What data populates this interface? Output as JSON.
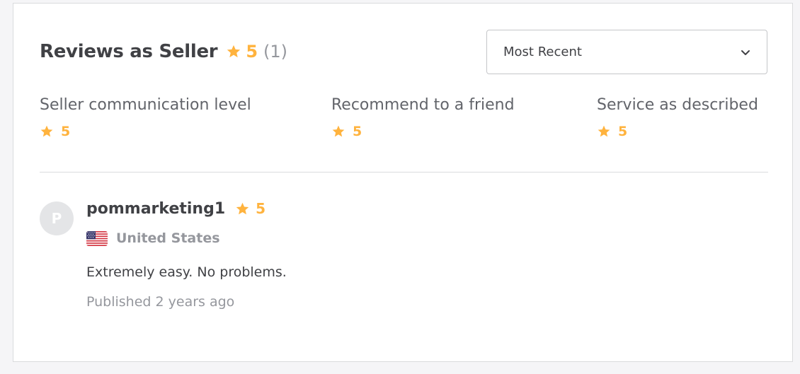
{
  "header": {
    "title": "Reviews as Seller",
    "rating": "5",
    "count": "(1)"
  },
  "sort": {
    "selected": "Most Recent"
  },
  "breakdown": [
    {
      "label": "Seller communication level",
      "value": "5"
    },
    {
      "label": "Recommend to a friend",
      "value": "5"
    },
    {
      "label": "Service as described",
      "value": "5"
    }
  ],
  "review": {
    "avatar_initial": "P",
    "username": "pommarketing1",
    "rating": "5",
    "country": "United States",
    "text": "Extremely easy. No problems.",
    "published": "Published 2 years ago"
  },
  "colors": {
    "star": "#ffb33e",
    "text_primary": "#404145",
    "text_muted": "#95979d"
  },
  "icons": {
    "rating": "star-icon",
    "sort_toggle": "chevron-down-icon",
    "country": "us-flag-icon"
  }
}
